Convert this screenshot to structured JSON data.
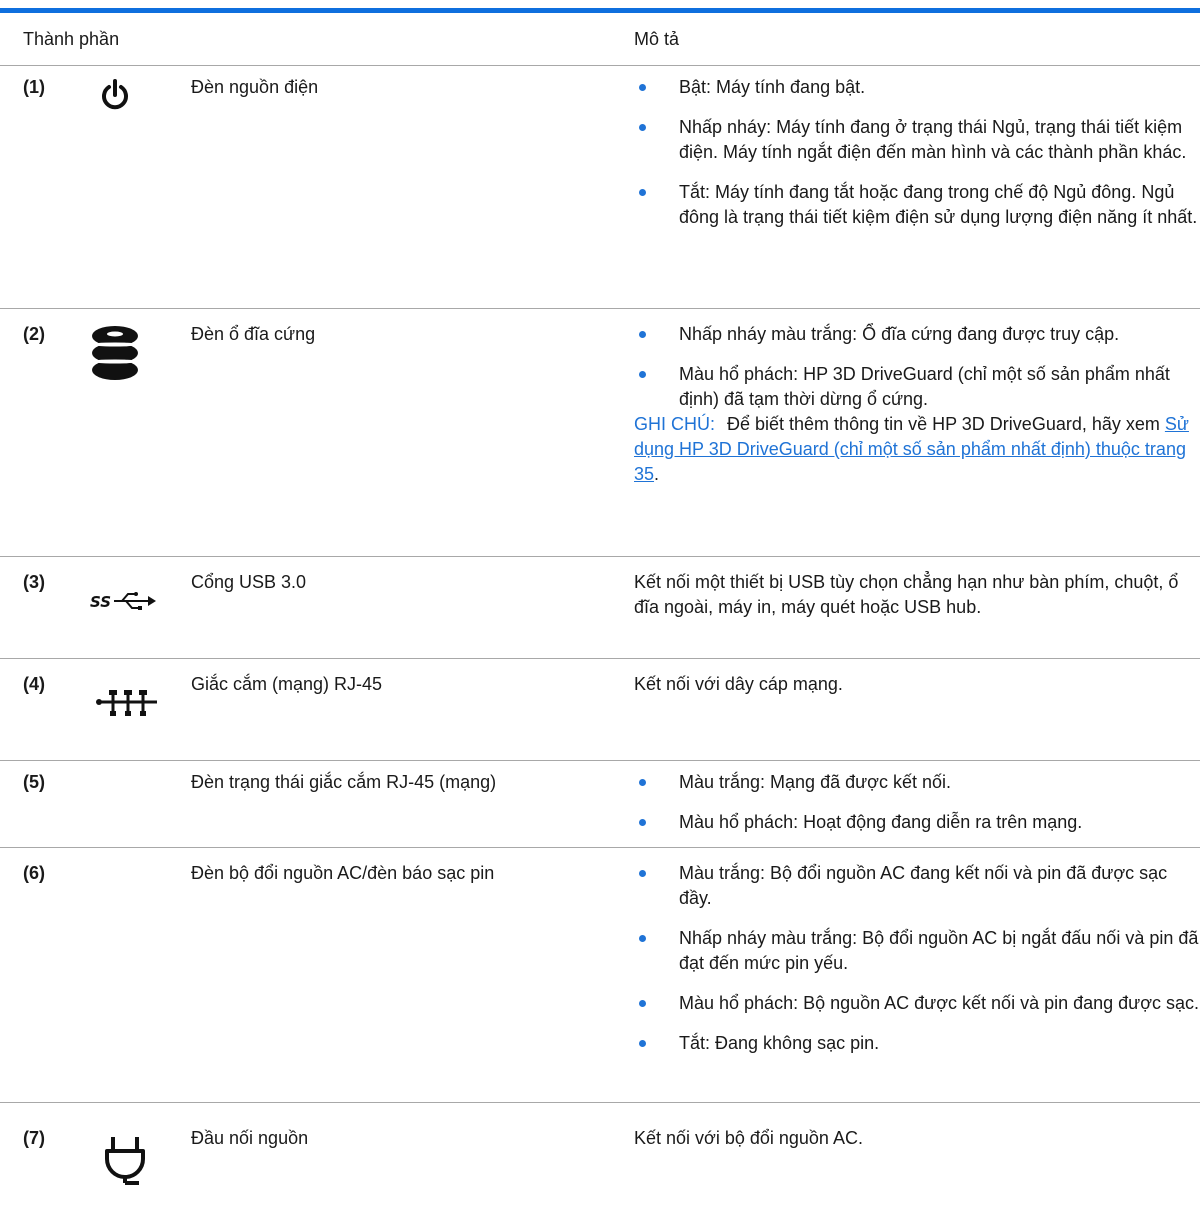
{
  "header": {
    "col_component": "Thành phần",
    "col_description": "Mô tả"
  },
  "rows": [
    {
      "num": "(1)",
      "icon": "power-icon",
      "component": "Đèn nguồn điện",
      "bullets": [
        "Bật: Máy tính đang bật.",
        "Nhấp nháy: Máy tính đang ở trạng thái Ngủ, trạng thái tiết kiệm điện. Máy tính ngắt điện đến màn hình và các thành phần khác.",
        "Tắt: Máy tính đang tắt hoặc đang trong chế độ Ngủ đông. Ngủ đông là trạng thái tiết kiệm điện sử dụng lượng điện năng ít nhất."
      ]
    },
    {
      "num": "(2)",
      "icon": "hard-drive-icon",
      "component": "Đèn ổ đĩa cứng",
      "bullets": [
        "Nhấp nháy màu trắng: Ổ đĩa cứng đang được truy cập.",
        "Màu hổ phách: HP 3D DriveGuard (chỉ một số sản phẩm nhất định) đã tạm thời dừng ổ cứng."
      ],
      "note": {
        "label": "GHI CHÚ:",
        "text": "Để biết thêm thông tin về HP 3D DriveGuard, hãy xem",
        "link": "Sử dụng HP 3D DriveGuard (chỉ một số sản phẩm nhất định) thuộc trang 35",
        "end": "."
      }
    },
    {
      "num": "(3)",
      "icon": "usb-superspeed-icon",
      "component": "Cổng USB 3.0",
      "text": "Kết nối một thiết bị USB tùy chọn chẳng hạn như bàn phím, chuột, ổ đĩa ngoài, máy in, máy quét hoặc USB hub."
    },
    {
      "num": "(4)",
      "icon": "network-icon",
      "component": "Giắc cắm (mạng) RJ-45",
      "text": "Kết nối với dây cáp mạng."
    },
    {
      "num": "(5)",
      "component": "Đèn trạng thái giắc cắm RJ-45 (mạng)",
      "bullets": [
        "Màu trắng: Mạng đã được kết nối.",
        "Màu hổ phách: Hoạt động đang diễn ra trên mạng."
      ]
    },
    {
      "num": "(6)",
      "component": "Đèn bộ đổi nguồn AC/đèn báo sạc pin",
      "bullets": [
        "Màu trắng: Bộ đổi nguồn AC đang kết nối và pin đã được sạc đầy.",
        "Nhấp nháy màu trắng: Bộ đổi nguồn AC bị ngắt đấu nối và pin đã đạt đến mức pin yếu.",
        "Màu hổ phách: Bộ nguồn AC được kết nối và pin đang được sạc.",
        "Tắt: Đang không sạc pin."
      ]
    },
    {
      "num": "(7)",
      "icon": "power-plug-icon",
      "component": "Đầu nối nguồn",
      "text": "Kết nối với bộ đổi nguồn AC."
    }
  ],
  "colors": {
    "accent": "#1f73d6",
    "rule": "#0f6fde",
    "divider": "#a8a8a8",
    "text": "#1a1a1a"
  }
}
